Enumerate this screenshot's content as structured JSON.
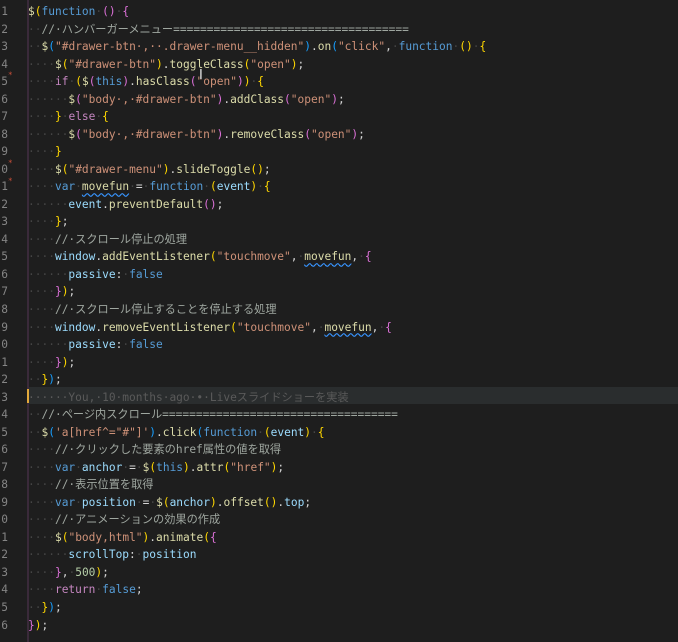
{
  "editor": {
    "language": "JavaScript",
    "theme_colors": {
      "background": "#1e1e1e",
      "function": "#dcdcaa",
      "keyword": "#c586c0",
      "string": "#ce9178",
      "comment": "#9fa7a0",
      "variable": "#9cdcfe",
      "line_number": "#858585",
      "git_modified": "#e2a93b"
    },
    "lines": [
      {
        "n": "1",
        "html": "<span class=\"t-fn\">$</span><span class=\"t-yel\">(</span><span class=\"t-kw2\">function</span><span class=\"t-dot\">·</span><span class=\"t-pur\">()</span><span class=\"t-dot\">·</span><span class=\"t-pur\">{</span>"
      },
      {
        "n": "2",
        "html": "<span class=\"t-dot\">··</span><span class=\"t-cm\">//·ハンバーガーメニュー===================================</span>"
      },
      {
        "n": "3",
        "html": "<span class=\"t-dot\">··</span><span class=\"t-fn\">$</span><span class=\"t-blu\">(</span><span class=\"t-str\">\"#drawer-btn·,··.drawer-menu__hidden\"</span><span class=\"t-blu\">)</span>.<span class=\"t-fn\">on</span><span class=\"t-blu\">(</span><span class=\"t-str\">\"click\"</span>,<span class=\"t-dot\">·</span><span class=\"t-kw2\">function</span><span class=\"t-dot\">·</span><span class=\"t-yel\">()</span><span class=\"t-dot\">·</span><span class=\"t-yel\">{</span>"
      },
      {
        "n": "4",
        "html": "<span class=\"t-dot\">····</span><span class=\"t-fn\">$</span><span class=\"t-yel\">(</span><span class=\"t-str\">\"#drawer-btn\"</span><span class=\"t-yel\">)</span>.<span class=\"t-fn\">toggleClass</span><span class=\"t-yel\">(</span><span class=\"t-str\">\"open\"</span><span class=\"t-yel\">)</span>;"
      },
      {
        "n": "5",
        "html": "<span class=\"t-dot\">····</span><span class=\"t-kw\">if</span><span class=\"t-dot\">·</span><span class=\"t-yel\">(</span><span class=\"t-fn\">$</span><span class=\"t-pur\">(</span><span class=\"t-kw2\">this</span><span class=\"t-pur\">)</span>.<span class=\"t-fn\">hasClass</span><span class=\"t-pur\">(</span><span class=\"t-str\">\"open\"</span><span class=\"t-pur\">)</span><span class=\"t-yel\">)</span><span class=\"t-dot\">·</span><span class=\"t-yel\">{</span>"
      },
      {
        "n": "6",
        "html": "<span class=\"t-dot\">······</span><span class=\"t-fn\">$</span><span class=\"t-pur\">(</span><span class=\"t-str\">\"body·,·#drawer-btn\"</span><span class=\"t-pur\">)</span>.<span class=\"t-fn\">addClass</span><span class=\"t-pur\">(</span><span class=\"t-str\">\"open\"</span><span class=\"t-pur\">)</span>;"
      },
      {
        "n": "7",
        "html": "<span class=\"t-dot\">····</span><span class=\"t-yel\">}</span><span class=\"t-dot\">·</span><span class=\"t-kw\">else</span><span class=\"t-dot\">·</span><span class=\"t-yel\">{</span>"
      },
      {
        "n": "8",
        "html": "<span class=\"t-dot\">······</span><span class=\"t-fn\">$</span><span class=\"t-pur\">(</span><span class=\"t-str\">\"body·,·#drawer-btn\"</span><span class=\"t-pur\">)</span>.<span class=\"t-fn\">removeClass</span><span class=\"t-pur\">(</span><span class=\"t-str\">\"open\"</span><span class=\"t-pur\">)</span>;"
      },
      {
        "n": "9",
        "html": "<span class=\"t-dot\">····</span><span class=\"t-yel\">}</span>"
      },
      {
        "n": "0",
        "html": "<span class=\"t-dot\">····</span><span class=\"t-fn\">$</span><span class=\"t-yel\">(</span><span class=\"t-str\">\"#drawer-menu\"</span><span class=\"t-yel\">)</span>.<span class=\"t-fn\">slideToggle</span><span class=\"t-yel\">()</span>;"
      },
      {
        "n": "1",
        "html": "<span class=\"t-dot\">····</span><span class=\"t-kw2\">var</span><span class=\"t-dot\">·</span><span class=\"t-fn squiggle\">movefun</span><span class=\"t-dot\">·</span>=<span class=\"t-dot\">·</span><span class=\"t-kw2\">function</span><span class=\"t-dot\">·</span><span class=\"t-yel\">(</span><span class=\"t-var\">event</span><span class=\"t-yel\">)</span><span class=\"t-dot\">·</span><span class=\"t-yel\">{</span>"
      },
      {
        "n": "2",
        "html": "<span class=\"t-dot\">······</span><span class=\"t-var\">event</span>.<span class=\"t-fn\">preventDefault</span><span class=\"t-pur\">()</span>;"
      },
      {
        "n": "3",
        "html": "<span class=\"t-dot\">····</span><span class=\"t-yel\">}</span>;"
      },
      {
        "n": "4",
        "html": "<span class=\"t-dot\">····</span><span class=\"t-cm\">//·スクロール停止の処理</span>"
      },
      {
        "n": "5",
        "html": "<span class=\"t-dot\">····</span><span class=\"t-var\">window</span>.<span class=\"t-fn\">addEventListener</span><span class=\"t-yel\">(</span><span class=\"t-str\">\"touchmove\"</span>,<span class=\"t-dot\">·</span><span class=\"t-fn squiggle\">movefun</span>,<span class=\"t-dot\">·</span><span class=\"t-pur\">{</span>"
      },
      {
        "n": "6",
        "html": "<span class=\"t-dot\">······</span><span class=\"t-var\">passive</span>:<span class=\"t-dot\">·</span><span class=\"t-kw2\">false</span>"
      },
      {
        "n": "7",
        "html": "<span class=\"t-dot\">····</span><span class=\"t-pur\">}</span><span class=\"t-yel\">)</span>;"
      },
      {
        "n": "8",
        "html": "<span class=\"t-dot\">····</span><span class=\"t-cm\">//·スクロール停止することを停止する処理</span>"
      },
      {
        "n": "9",
        "html": "<span class=\"t-dot\">····</span><span class=\"t-var\">window</span>.<span class=\"t-fn\">removeEventListener</span><span class=\"t-yel\">(</span><span class=\"t-str\">\"touchmove\"</span>,<span class=\"t-dot\">·</span><span class=\"t-fn squiggle\">movefun</span>,<span class=\"t-dot\">·</span><span class=\"t-pur\">{</span>"
      },
      {
        "n": "0",
        "html": "<span class=\"t-dot\">······</span><span class=\"t-var\">passive</span>:<span class=\"t-dot\">·</span><span class=\"t-kw2\">false</span>"
      },
      {
        "n": "1",
        "html": "<span class=\"t-dot\">····</span><span class=\"t-pur\">}</span><span class=\"t-yel\">)</span>;"
      },
      {
        "n": "2",
        "html": "<span class=\"t-dot\">··</span><span class=\"t-yel\">}</span><span class=\"t-blu\">)</span>;"
      },
      {
        "n": "3",
        "html": "<span class=\"t-blame\">······You,·10·months·ago·•·Liveスライドショーを実装</span>"
      },
      {
        "n": "4",
        "html": "<span class=\"t-dot\">··</span><span class=\"t-cm\">//·ページ内スクロール===================================</span>"
      },
      {
        "n": "5",
        "html": "<span class=\"t-dot\">··</span><span class=\"t-fn\">$</span><span class=\"t-blu\">(</span><span class=\"t-str\">'a[href^=\"#\"]'</span><span class=\"t-blu\">)</span>.<span class=\"t-fn\">click</span><span class=\"t-blu\">(</span><span class=\"t-kw2\">function</span><span class=\"t-dot\">·</span><span class=\"t-yel\">(</span><span class=\"t-var\">event</span><span class=\"t-yel\">)</span><span class=\"t-dot\">·</span><span class=\"t-yel\">{</span>"
      },
      {
        "n": "6",
        "html": "<span class=\"t-dot\">····</span><span class=\"t-cm\">//·クリックした要素のhref属性の値を取得</span>"
      },
      {
        "n": "7",
        "html": "<span class=\"t-dot\">····</span><span class=\"t-kw2\">var</span><span class=\"t-dot\">·</span><span class=\"t-var\">anchor</span><span class=\"t-dot\">·</span>=<span class=\"t-dot\">·</span><span class=\"t-fn\">$</span><span class=\"t-yel\">(</span><span class=\"t-kw2\">this</span><span class=\"t-yel\">)</span>.<span class=\"t-fn\">attr</span><span class=\"t-yel\">(</span><span class=\"t-str\">\"href\"</span><span class=\"t-yel\">)</span>;"
      },
      {
        "n": "8",
        "html": "<span class=\"t-dot\">····</span><span class=\"t-cm\">//·表示位置を取得</span>"
      },
      {
        "n": "9",
        "html": "<span class=\"t-dot\">····</span><span class=\"t-kw2\">var</span><span class=\"t-dot\">·</span><span class=\"t-var\">position</span><span class=\"t-dot\">·</span>=<span class=\"t-dot\">·</span><span class=\"t-fn\">$</span><span class=\"t-yel\">(</span><span class=\"t-var\">anchor</span><span class=\"t-yel\">)</span>.<span class=\"t-fn\">offset</span><span class=\"t-yel\">()</span>.<span class=\"t-var\">top</span>;"
      },
      {
        "n": "0",
        "html": "<span class=\"t-dot\">····</span><span class=\"t-cm\">//·アニメーションの効果の作成</span>"
      },
      {
        "n": "1",
        "html": "<span class=\"t-dot\">····</span><span class=\"t-fn\">$</span><span class=\"t-yel\">(</span><span class=\"t-str\">\"body,html\"</span><span class=\"t-yel\">)</span>.<span class=\"t-fn\">animate</span><span class=\"t-yel\">(</span><span class=\"t-pur\">{</span>"
      },
      {
        "n": "2",
        "html": "<span class=\"t-dot\">······</span><span class=\"t-var\">scrollTop</span>:<span class=\"t-dot\">·</span><span class=\"t-var\">position</span>"
      },
      {
        "n": "3",
        "html": "<span class=\"t-dot\">····</span><span class=\"t-pur\">}</span>,<span class=\"t-dot\">·</span><span class=\"t-num\">500</span><span class=\"t-yel\">)</span>;"
      },
      {
        "n": "4",
        "html": "<span class=\"t-dot\">····</span><span class=\"t-kw\">return</span><span class=\"t-dot\">·</span><span class=\"t-kw2\">false</span>;"
      },
      {
        "n": "5",
        "html": "<span class=\"t-dot\">··</span><span class=\"t-yel\">}</span><span class=\"t-blu\">)</span>;"
      },
      {
        "n": "6",
        "html": "<span class=\"t-pur\">}</span><span class=\"t-yel\">)</span>;"
      }
    ]
  },
  "blame": {
    "text": "You, 10 months ago • Liveスライドショーを実装"
  },
  "cursor": {
    "icon": "text-cursor-ibeam-icon"
  }
}
